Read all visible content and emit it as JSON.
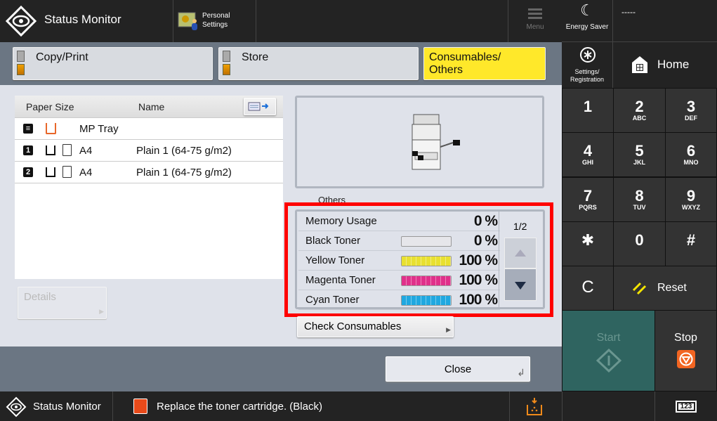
{
  "header": {
    "title": "Status Monitor",
    "personal_settings": "Personal Settings",
    "menu": "Menu"
  },
  "tabs": [
    {
      "label": "Copy/Print",
      "active": false
    },
    {
      "label": "Store",
      "active": false
    },
    {
      "label": "Consumables/ Others",
      "active": true
    }
  ],
  "paper_table": {
    "columns": [
      "Paper Size",
      "Name"
    ],
    "rows": [
      {
        "source": "MP Tray",
        "size": "",
        "name": ""
      },
      {
        "source": "1",
        "size": "A4",
        "name": "Plain 1 (64-75 g/m2)"
      },
      {
        "source": "2",
        "size": "A4",
        "name": "Plain 1 (64-75 g/m2)"
      }
    ]
  },
  "details_button": "Details",
  "others_label": "Others",
  "consumables": {
    "page": "1/2",
    "items": [
      {
        "label": "Memory Usage",
        "value": "0 %",
        "level": 0,
        "color": null
      },
      {
        "label": "Black Toner",
        "value": "0 %",
        "level": 0,
        "color": "#333333"
      },
      {
        "label": "Yellow Toner",
        "value": "100 %",
        "level": 100,
        "color": "#e8e030"
      },
      {
        "label": "Magenta Toner",
        "value": "100 %",
        "level": 100,
        "color": "#e0308a"
      },
      {
        "label": "Cyan Toner",
        "value": "100 %",
        "level": 100,
        "color": "#20a8e0"
      }
    ]
  },
  "check_consumables": "Check Consumables",
  "close": "Close",
  "right": {
    "energy_saver": "Energy Saver",
    "login_display": "-----",
    "settings": "Settings/ Registration",
    "home": "Home",
    "keys": [
      {
        "n": "1",
        "s": ""
      },
      {
        "n": "2",
        "s": "ABC"
      },
      {
        "n": "3",
        "s": "DEF"
      },
      {
        "n": "4",
        "s": "GHI"
      },
      {
        "n": "5",
        "s": "JKL"
      },
      {
        "n": "6",
        "s": "MNO"
      },
      {
        "n": "7",
        "s": "PQRS"
      },
      {
        "n": "8",
        "s": "TUV"
      },
      {
        "n": "9",
        "s": "WXYZ"
      },
      {
        "n": "✱",
        "s": ""
      },
      {
        "n": "0",
        "s": ""
      },
      {
        "n": "#",
        "s": ""
      }
    ],
    "clear": "C",
    "reset": "Reset",
    "start": "Start",
    "stop": "Stop",
    "numeric_badge": "123"
  },
  "statusbar": {
    "title": "Status Monitor",
    "message": "Replace the toner cartridge. (Black)"
  },
  "colors": {
    "accent_yellow": "#ffe82a",
    "highlight_red": "#ff0000",
    "start_green": "#2f6460",
    "stop_orange": "#f26522"
  }
}
